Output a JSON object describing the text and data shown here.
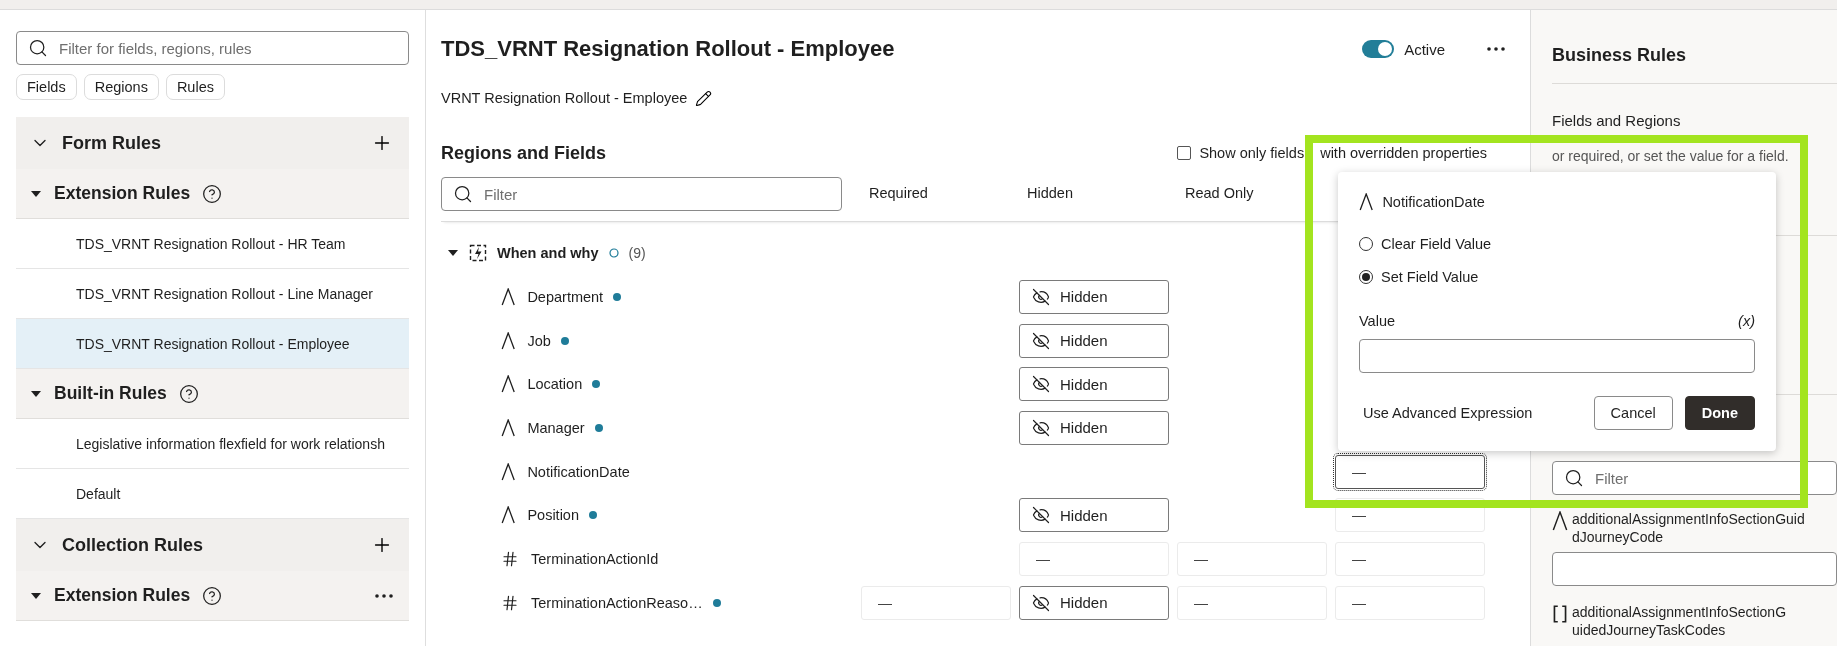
{
  "left_panel": {
    "search": {
      "placeholder": "Filter for fields, regions, rules"
    },
    "chips": [
      {
        "label": "Fields"
      },
      {
        "label": "Regions"
      },
      {
        "label": "Rules"
      }
    ],
    "sections": [
      {
        "title": "Form Rules",
        "expanded": true,
        "action": {
          "kind": "add"
        },
        "children": [
          {
            "title": "Extension Rules",
            "expanded": true,
            "items": [
              {
                "label": "TDS_VRNT Resignation Rollout - HR Team",
                "selected": false
              },
              {
                "label": "TDS_VRNT Resignation Rollout - Line Manager",
                "selected": false
              },
              {
                "label": "TDS_VRNT Resignation Rollout - Employee",
                "selected": true
              }
            ]
          },
          {
            "title": "Built-in Rules",
            "expanded": true,
            "items": [
              {
                "label": "Legislative information flexfield for work relationsh",
                "selected": false
              },
              {
                "label": "Default",
                "selected": false
              }
            ]
          }
        ]
      },
      {
        "title": "Collection Rules",
        "expanded": true,
        "action": {
          "kind": "add"
        },
        "children": [
          {
            "title": "Extension Rules",
            "expanded": true,
            "action": {
              "kind": "more"
            }
          }
        ]
      }
    ]
  },
  "editor": {
    "title": "TDS_VRNT Resignation Rollout - Employee",
    "status": {
      "label": "Active",
      "on": true
    },
    "subtitle": "VRNT Resignation Rollout - Employee",
    "regions": {
      "title": "Regions and Fields",
      "overridden_filter": {
        "label": "Show only fields",
        "label_continued": "with overridden properties",
        "checked": false
      },
      "filter": {
        "placeholder": "Filter"
      },
      "columns": [
        "Required",
        "Hidden",
        "Read Only"
      ],
      "group": {
        "name": "When and why",
        "count": "(9)",
        "expanded": true,
        "fields": [
          {
            "name": "Department",
            "kind": "text",
            "modified": true,
            "cells": [
              null,
              {
                "kind": "hidden",
                "label": "Hidden"
              },
              null,
              null
            ]
          },
          {
            "name": "Job",
            "kind": "text",
            "modified": true,
            "cells": [
              null,
              {
                "kind": "hidden",
                "label": "Hidden"
              },
              null,
              null
            ]
          },
          {
            "name": "Location",
            "kind": "text",
            "modified": true,
            "cells": [
              null,
              {
                "kind": "hidden",
                "label": "Hidden"
              },
              null,
              null
            ]
          },
          {
            "name": "Manager",
            "kind": "text",
            "modified": true,
            "cells": [
              null,
              {
                "kind": "hidden",
                "label": "Hidden"
              },
              null,
              null
            ]
          },
          {
            "name": "NotificationDate",
            "kind": "text",
            "modified": false,
            "cells": [
              null,
              null,
              null,
              {
                "kind": "dash",
                "label": "—",
                "focused": true
              }
            ]
          },
          {
            "name": "Position",
            "kind": "text",
            "modified": true,
            "cells": [
              null,
              {
                "kind": "hidden",
                "label": "Hidden"
              },
              null,
              {
                "kind": "dash",
                "label": "—",
                "focused": false
              }
            ]
          },
          {
            "name": "TerminationActionId",
            "kind": "number",
            "modified": false,
            "cells": [
              null,
              {
                "kind": "dash",
                "label": "—",
                "focused": false
              },
              {
                "kind": "dash",
                "label": "—",
                "focused": false
              },
              {
                "kind": "dash",
                "label": "—",
                "focused": false
              }
            ]
          },
          {
            "name": "TerminationActionReaso…",
            "kind": "number",
            "modified": true,
            "cells": [
              {
                "kind": "dash",
                "label": "—",
                "focused": false
              },
              {
                "kind": "hidden",
                "label": "Hidden"
              },
              {
                "kind": "dash",
                "label": "—",
                "focused": false
              },
              {
                "kind": "dash",
                "label": "—",
                "focused": false
              }
            ]
          }
        ]
      }
    }
  },
  "popup": {
    "field": {
      "name": "NotificationDate",
      "kind": "text"
    },
    "options": [
      {
        "label": "Clear Field Value",
        "selected": false
      },
      {
        "label": "Set Field Value",
        "selected": true
      }
    ],
    "value_label": "Value",
    "expression": "(x)",
    "link": "Use Advanced Expression",
    "buttons": [
      {
        "label": "Cancel",
        "kind": "secondary"
      },
      {
        "label": "Done",
        "kind": "primary"
      }
    ]
  },
  "right_panel": {
    "title": "Business Rules",
    "section_title": "Fields and Regions",
    "description": "or required, or set the value for a field.",
    "filter": {
      "placeholder": "Filter"
    },
    "fields": [
      {
        "kind": "text",
        "lines": [
          "additionalAssignmentInfoSectionGuid",
          "dJourneyCode"
        ],
        "input": true
      },
      {
        "kind": "array",
        "lines": [
          "additionalAssignmentInfoSectionG",
          "uidedJourneyTaskCodes"
        ],
        "input": false
      }
    ]
  }
}
